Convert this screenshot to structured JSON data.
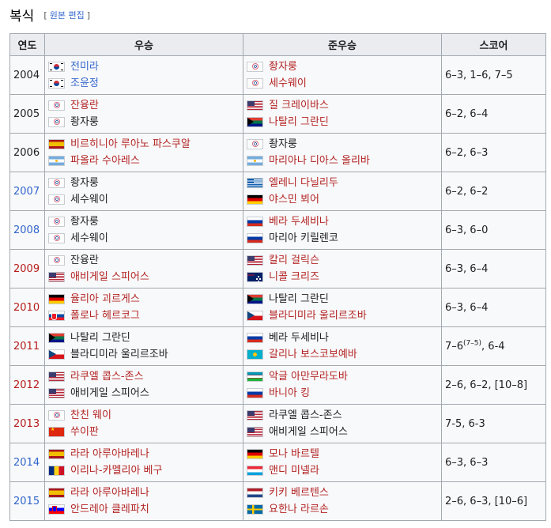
{
  "heading": {
    "title": "복식",
    "edit_bracket_open": "[",
    "edit_source": "원본 편집",
    "edit_bracket_close": "]"
  },
  "columns": [
    "연도",
    "우승",
    "준우승",
    "스코어"
  ],
  "rows": [
    {
      "year": "2004",
      "year_style": "black",
      "winners": [
        {
          "flag": "kor",
          "name": "전미라",
          "style": "blue"
        },
        {
          "flag": "kor",
          "name": "조윤정",
          "style": "blue"
        }
      ],
      "runners": [
        {
          "flag": "tpe",
          "name": "좡자룽",
          "style": "link"
        },
        {
          "flag": "tpe",
          "name": "세수웨이",
          "style": "link"
        }
      ],
      "score": "6–3, 1–6, 7–5"
    },
    {
      "year": "2005",
      "year_style": "black",
      "winners": [
        {
          "flag": "tpe",
          "name": "잔융란",
          "style": "link"
        },
        {
          "flag": "tpe",
          "name": "좡자룽",
          "style": "blk"
        }
      ],
      "runners": [
        {
          "flag": "usa",
          "name": "질 크레이바스",
          "style": "link"
        },
        {
          "flag": "rsa",
          "name": "나탈리 그란딘",
          "style": "link"
        }
      ],
      "score": "6–2, 6–4"
    },
    {
      "year": "2006",
      "year_style": "black",
      "winners": [
        {
          "flag": "esp",
          "name": "비르히니아 루아노 파스쿠알",
          "style": "link"
        },
        {
          "flag": "arg",
          "name": "파올라 수아레스",
          "style": "link"
        }
      ],
      "runners": [
        {
          "flag": "tpe",
          "name": "좡자룽",
          "style": "blk"
        },
        {
          "flag": "arg",
          "name": "마리아나 디아스 올리바",
          "style": "link"
        }
      ],
      "score": "6–2, 6–3"
    },
    {
      "year": "2007",
      "year_style": "blue",
      "winners": [
        {
          "flag": "tpe",
          "name": "좡자룽",
          "style": "blk"
        },
        {
          "flag": "tpe",
          "name": "세수웨이",
          "style": "blk"
        }
      ],
      "runners": [
        {
          "flag": "gre",
          "name": "엘레니 다닐리두",
          "style": "link"
        },
        {
          "flag": "ger",
          "name": "야스민 뵈어",
          "style": "link"
        }
      ],
      "score": "6–2, 6–2"
    },
    {
      "year": "2008",
      "year_style": "blue",
      "winners": [
        {
          "flag": "tpe",
          "name": "좡자룽",
          "style": "blk"
        },
        {
          "flag": "tpe",
          "name": "세수웨이",
          "style": "blk"
        }
      ],
      "runners": [
        {
          "flag": "rus",
          "name": "베라 두세비나",
          "style": "link"
        },
        {
          "flag": "rus",
          "name": "마리아 키릴렌코",
          "style": "blk"
        }
      ],
      "score": "6–3, 6–0"
    },
    {
      "year": "2009",
      "year_style": "red",
      "winners": [
        {
          "flag": "tpe",
          "name": "잔융란",
          "style": "blk"
        },
        {
          "flag": "usa",
          "name": "애비게일 스피어스",
          "style": "link"
        }
      ],
      "runners": [
        {
          "flag": "usa",
          "name": "칼리 걸릭슨",
          "style": "link"
        },
        {
          "flag": "aus",
          "name": "니콜 크리즈",
          "style": "link"
        }
      ],
      "score": "6–3, 6–4"
    },
    {
      "year": "2010",
      "year_style": "red",
      "winners": [
        {
          "flag": "ger",
          "name": "율리아 괴르게스",
          "style": "link"
        },
        {
          "flag": "svk",
          "name": "폴로나 헤르코그",
          "style": "link"
        }
      ],
      "runners": [
        {
          "flag": "rsa",
          "name": "나탈리 그란딘",
          "style": "blk"
        },
        {
          "flag": "cze",
          "name": "블라디미라 울리르조바",
          "style": "link"
        }
      ],
      "score": "6–3, 6–4"
    },
    {
      "year": "2011",
      "year_style": "red",
      "winners": [
        {
          "flag": "rsa",
          "name": "나탈리 그란딘",
          "style": "blk"
        },
        {
          "flag": "cze",
          "name": "블라디미라 울리르조바",
          "style": "blk"
        }
      ],
      "runners": [
        {
          "flag": "rus",
          "name": "베라 두세비나",
          "style": "blk"
        },
        {
          "flag": "kaz",
          "name": "갈리나 보스코보예바",
          "style": "link"
        }
      ],
      "score_main": "7–6",
      "score_sup": "(7–5)",
      "score_rest": ", 6-4"
    },
    {
      "year": "2012",
      "year_style": "red",
      "winners": [
        {
          "flag": "usa",
          "name": "라쿠엘 콥스-존스",
          "style": "link"
        },
        {
          "flag": "usa",
          "name": "애비게일 스피어스",
          "style": "blk"
        }
      ],
      "runners": [
        {
          "flag": "uzb",
          "name": "악글 아만무라도바",
          "style": "link"
        },
        {
          "flag": "rus",
          "name": "바니아 킹",
          "style": "link"
        }
      ],
      "score": "2–6, 6–2, [10–8]"
    },
    {
      "year": "2013",
      "year_style": "red",
      "winners": [
        {
          "flag": "tpe",
          "name": "찬친 웨이",
          "style": "link"
        },
        {
          "flag": "chn",
          "name": "쑤이판",
          "style": "link"
        }
      ],
      "runners": [
        {
          "flag": "usa",
          "name": "라쿠엘 콥스-존스",
          "style": "blk"
        },
        {
          "flag": "usa",
          "name": "애비게일 스피어스",
          "style": "blk"
        }
      ],
      "score": "7-5, 6-3"
    },
    {
      "year": "2014",
      "year_style": "blue",
      "winners": [
        {
          "flag": "esp",
          "name": "라라 아루아바레나",
          "style": "link"
        },
        {
          "flag": "rou",
          "name": "이리나-카멜리아 베구",
          "style": "link"
        }
      ],
      "runners": [
        {
          "flag": "ger",
          "name": "모나 바르텔",
          "style": "link"
        },
        {
          "flag": "lux",
          "name": "맨디 미넬라",
          "style": "link"
        }
      ],
      "score": "6–3, 6–3"
    },
    {
      "year": "2015",
      "year_style": "blue",
      "winners": [
        {
          "flag": "esp",
          "name": "라라 아루아바레나",
          "style": "link"
        },
        {
          "flag": "slo",
          "name": "안드레아 클레파치",
          "style": "link"
        }
      ],
      "runners": [
        {
          "flag": "ned",
          "name": "키키 베르텐스",
          "style": "link"
        },
        {
          "flag": "swe",
          "name": "요한나 라르손",
          "style": "link"
        }
      ],
      "score": "2–6, 6–3, [10–6]"
    }
  ]
}
